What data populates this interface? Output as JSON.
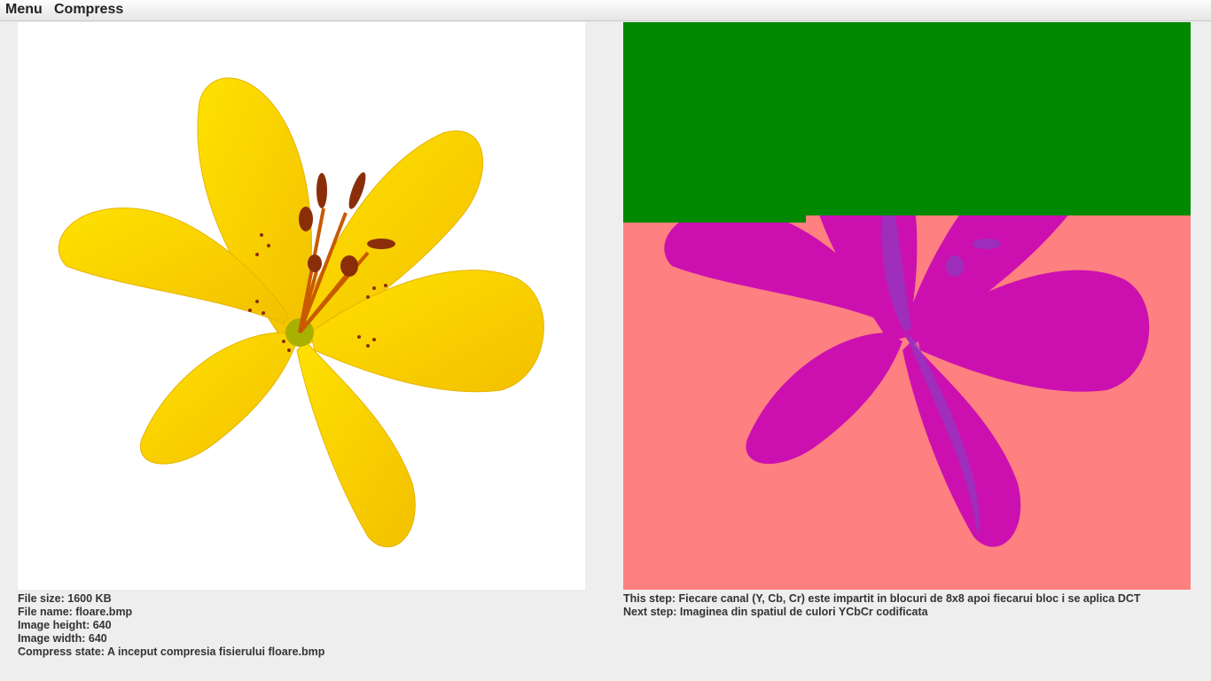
{
  "menubar": {
    "items": [
      "Menu",
      "Compress"
    ]
  },
  "original_image": {
    "info": {
      "file_size": "File size: 1600 KB",
      "file_name": "File name: floare.bmp",
      "image_height": "Image height: 640",
      "image_width": "Image width: 640",
      "compress_state": "Compress state: A inceput compresia fisierului floare.bmp"
    }
  },
  "processed_image": {
    "colors": {
      "background": "#ff8080",
      "processed_region": "#008800",
      "flower_main": "#cc10b0",
      "flower_shadow": "#8a3cc0"
    },
    "processed_fraction": 0.34,
    "steps": {
      "this_step": "This step: Fiecare canal (Y, Cb, Cr) este impartit in blocuri de 8x8 apoi fiecarui bloc i se aplica DCT",
      "next_step": "Next step: Imaginea din spatiul de culori YCbCr codificata"
    }
  }
}
